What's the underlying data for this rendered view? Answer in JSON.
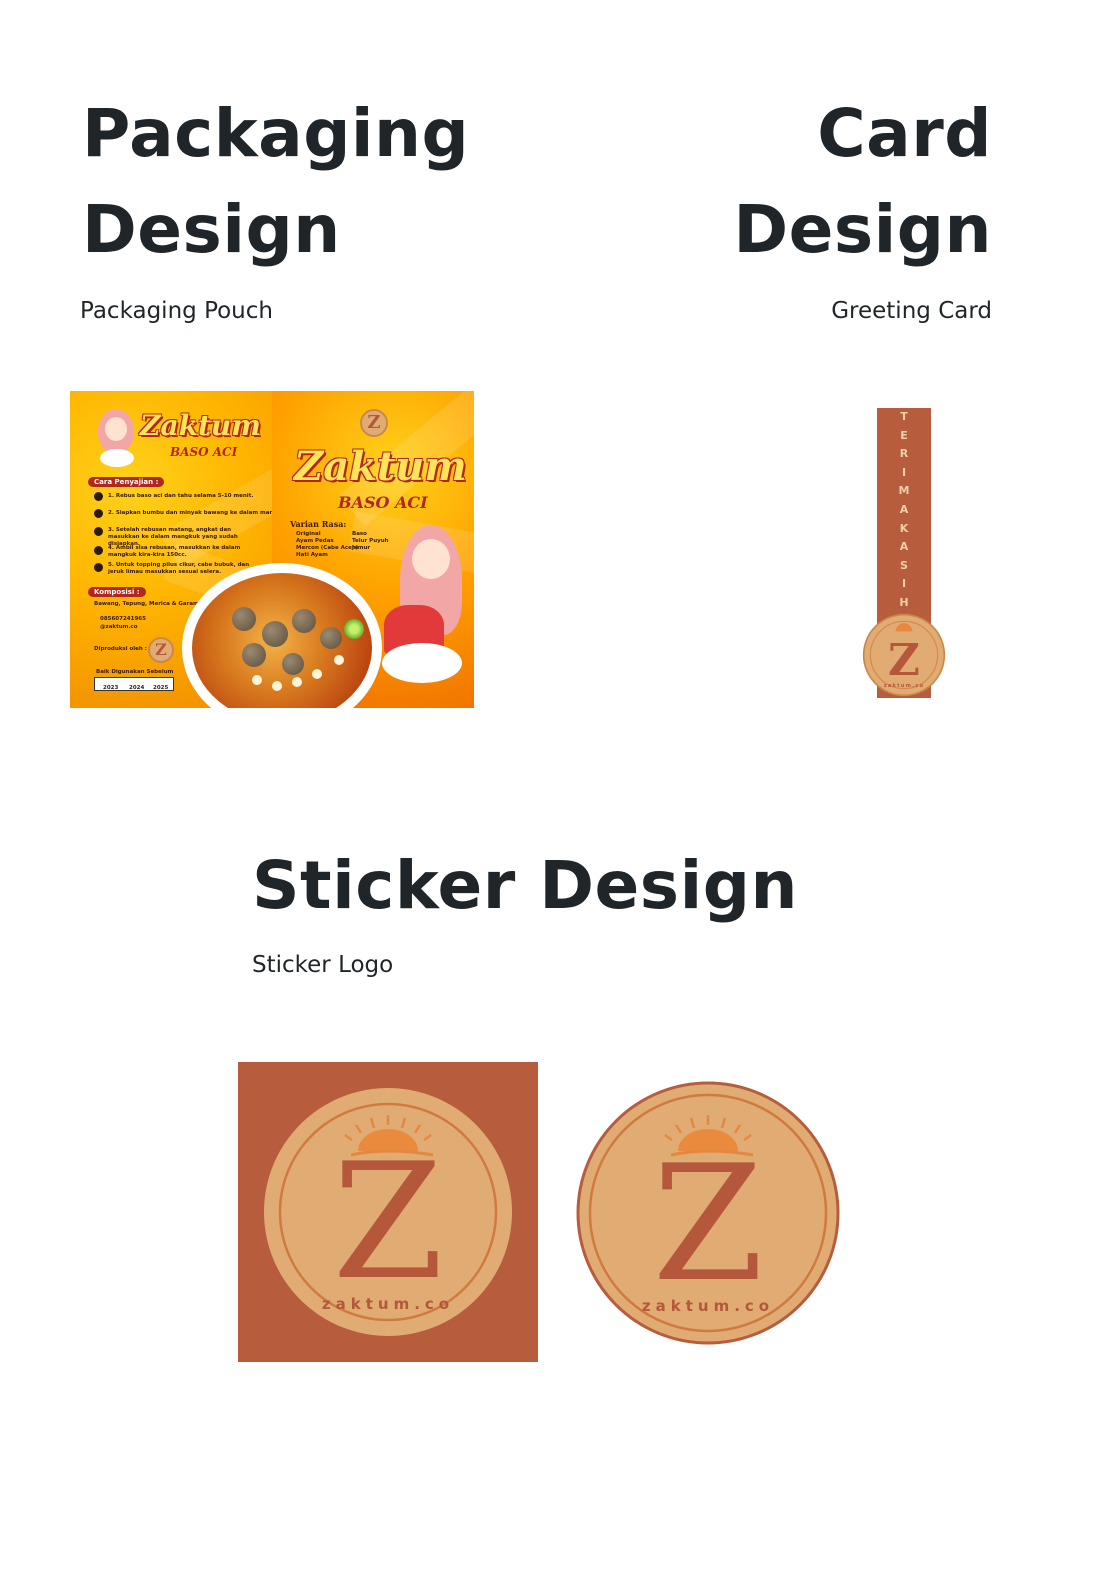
{
  "sections": {
    "packaging": {
      "title_line1": "Packaging",
      "title_line2": "Design",
      "subtitle": "Packaging Pouch"
    },
    "card": {
      "title_line1": "Card",
      "title_line2": "Design",
      "subtitle": "Greeting Card"
    },
    "sticker": {
      "title": "Sticker Design",
      "subtitle": "Sticker Logo"
    }
  },
  "pouch": {
    "brand": "Zaktum",
    "product": "BASO ACI",
    "how_to_serve_label": "Cara Penyajian :",
    "steps": [
      "1. Rebus baso aci dan tahu selama 5-10 menit.",
      "2. Siapkan bumbu dan minyak bawang ke dalam mangkuk.",
      "3. Setelah rebusan matang, angkat dan masukkan ke dalam mangkuk yang sudah disiapkan.",
      "4. Ambil sisa rebusan, masukkan ke dalam mangkuk kira-kira 150cc.",
      "5. Untuk topping pilus cikur, cabe bubuk, dan jeruk limau masukkan sesuai selera."
    ],
    "composition_label": "Komposisi :",
    "composition": "Bawang, Tepung, Merica & Garam",
    "phone": "085607241965",
    "instagram": "@zaktum.co",
    "produced_by_label": "Diproduksi oleh :",
    "best_before_label": "Baik Digunakan Sebelum",
    "years": [
      "2023",
      "2024",
      "2025"
    ],
    "variants_label": "Varian Rasa:",
    "variants": [
      "Original",
      "Ayam Pedas",
      "Mercon (Cabe Aceh)",
      "Hati Ayam",
      "Baso",
      "Telur Puyuh",
      "Jamur"
    ],
    "badge_letter": "Z"
  },
  "card_letters": [
    "T",
    "E",
    "R",
    "I",
    "M",
    "A",
    "K",
    "A",
    "S",
    "I",
    "H"
  ],
  "logo": {
    "letter": "Z",
    "text": "zaktum.co",
    "color_bg": "#b75d3e",
    "color_disc": "#e1ac74",
    "color_ring": "#c9884a",
    "color_letter": "#b4573b"
  }
}
